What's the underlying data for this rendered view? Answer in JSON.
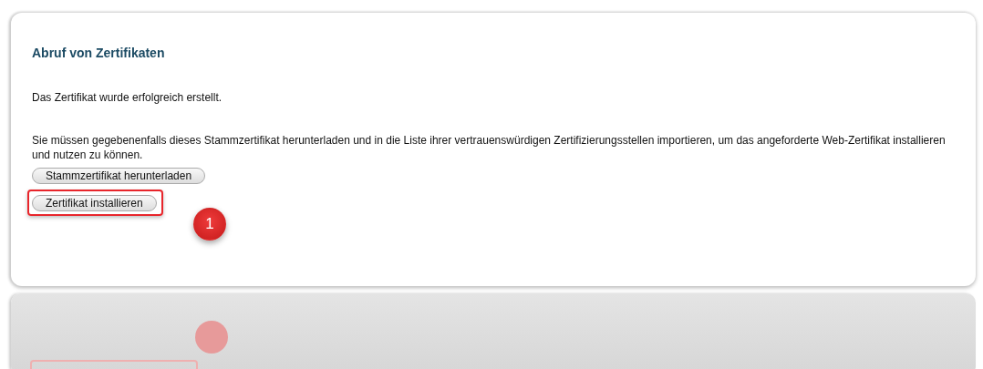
{
  "panel": {
    "title": "Abruf von Zertifikaten",
    "message": "Das Zertifikat wurde erfolgreich erstellt.",
    "instructions": "Sie müssen gegebenenfalls dieses Stammzertifikat herunterladen und in die Liste ihrer vertrauenswürdigen Zertifizierungsstellen importieren, um das angeforderte Web-Zertifikat installieren und nutzen zu können.",
    "buttons": [
      {
        "label": "Stammzertifikat herunterladen",
        "highlighted": false
      },
      {
        "label": "Zertifikat installieren",
        "highlighted": true,
        "step": "1"
      }
    ]
  }
}
